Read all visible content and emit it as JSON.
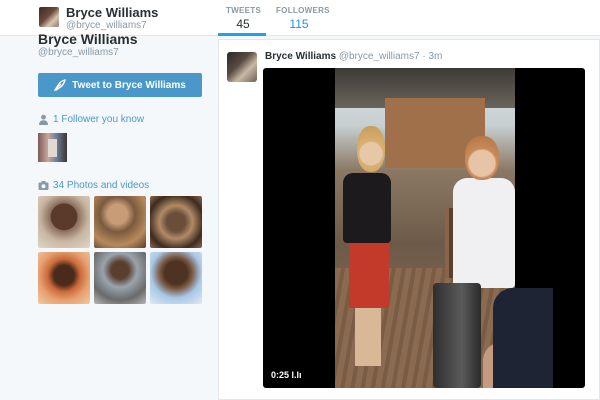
{
  "header": {
    "name": "Bryce Williams",
    "handle": "@bryce_williams7",
    "stats": [
      {
        "label": "TWEETS",
        "value": "45"
      },
      {
        "label": "FOLLOWERS",
        "value": "115"
      }
    ]
  },
  "profile": {
    "name": "Bryce Williams",
    "handle": "@bryce_williams7",
    "tweet_to_label": "Tweet to Bryce Williams",
    "followers_known": "1 Follower you know",
    "photos_label": "34 Photos and videos"
  },
  "tweet": {
    "name": "Bryce Williams",
    "handle": "@bryce_williams7",
    "dot": "·",
    "time": "3m",
    "video_time": "0:25 l.lı"
  },
  "colors": {
    "accent": "#1da1f2",
    "button": "#4a98c9",
    "link": "#4a98c9",
    "muted": "#8899a6"
  },
  "icons": {
    "tweet_button": "quill-icon",
    "followers": "person-icon",
    "photos": "camera-icon"
  }
}
